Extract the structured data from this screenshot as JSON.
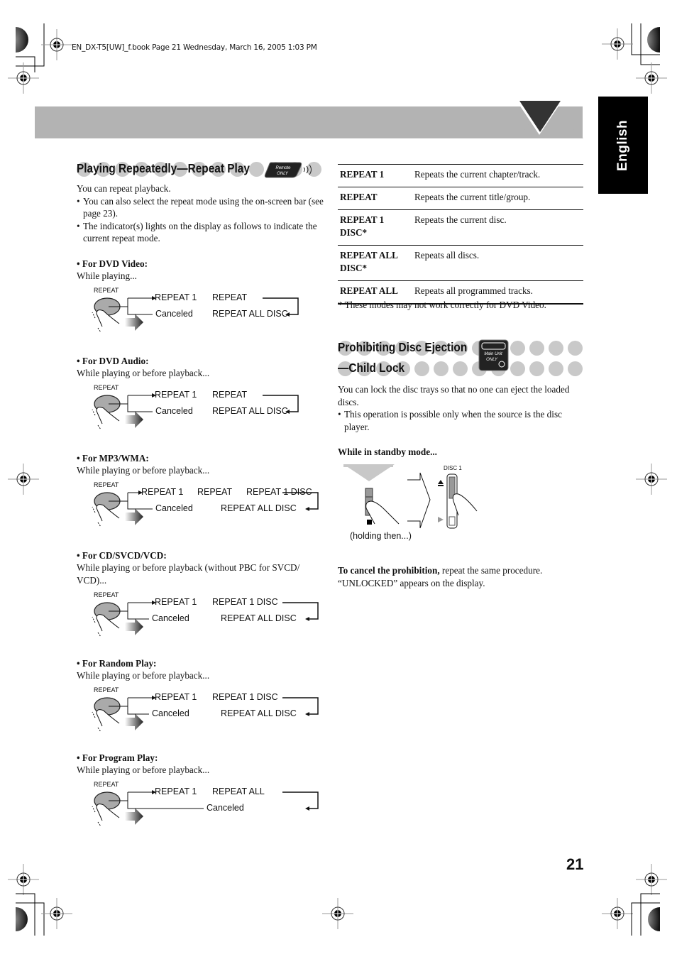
{
  "print_header": "EN_DX-T5[UW]_f.book  Page 21  Wednesday, March 16, 2005  1:03 PM",
  "language_tab": "English",
  "page_number": "21",
  "left": {
    "title": "Playing Repeatedly—Repeat Play",
    "badge": {
      "line1": "Remote",
      "line2": "ONLY"
    },
    "intro": "You can repeat playback.",
    "bullets": [
      "You can also select the repeat mode using the on-screen bar (see page 23).",
      "The indicator(s) lights on the display as follows to indicate the current repeat mode."
    ],
    "button_label": "REPEAT",
    "cases": [
      {
        "title": "• For DVD Video:",
        "condition": "While playing...",
        "top": [
          "REPEAT 1",
          "REPEAT"
        ],
        "bottom": [
          "Canceled",
          "REPEAT ALL DISC"
        ]
      },
      {
        "title": "• For DVD Audio:",
        "condition": "While playing or before playback...",
        "top": [
          "REPEAT 1",
          "REPEAT"
        ],
        "bottom": [
          "Canceled",
          "REPEAT ALL DISC"
        ]
      },
      {
        "title": "• For MP3/WMA:",
        "condition": "While playing or before playback...",
        "top": [
          "REPEAT 1",
          "REPEAT",
          "REPEAT 1 DISC"
        ],
        "bottom": [
          "Canceled",
          "REPEAT ALL DISC"
        ]
      },
      {
        "title": "• For CD/SVCD/VCD:",
        "condition": "While playing or before playback (without PBC for SVCD/ VCD)...",
        "top": [
          "REPEAT 1",
          "REPEAT 1 DISC"
        ],
        "bottom": [
          "Canceled",
          "REPEAT ALL DISC"
        ]
      },
      {
        "title": "• For Random Play:",
        "condition": "While playing or before playback...",
        "top": [
          "REPEAT 1",
          "REPEAT 1 DISC"
        ],
        "bottom": [
          "Canceled",
          "REPEAT ALL DISC"
        ]
      },
      {
        "title": "• For Program Play:",
        "condition": "While playing or before playback...",
        "top": [
          "REPEAT 1",
          "REPEAT ALL"
        ],
        "bottom": [
          "Canceled"
        ]
      }
    ]
  },
  "right": {
    "modes_table": [
      {
        "mode": "REPEAT 1",
        "desc": "Repeats the current chapter/track."
      },
      {
        "mode": "REPEAT",
        "desc": "Repeats the current title/group."
      },
      {
        "mode": "REPEAT 1 DISC*",
        "desc": "Repeats the current disc."
      },
      {
        "mode": "REPEAT ALL DISC*",
        "desc": "Repeats all discs."
      },
      {
        "mode": "REPEAT ALL",
        "desc": "Repeats all programmed tracks."
      }
    ],
    "footnote": "* These modes may not work correctly for DVD Video.",
    "title_line1": "Prohibiting Disc Ejection",
    "title_line2": "—Child Lock",
    "badge": {
      "line1": "Main Unit",
      "line2": "ONLY"
    },
    "intro": "You can lock the disc trays so that no one can eject the loaded discs.",
    "bullet": "This operation is possible only when the source is the disc player.",
    "standby_label": "While in standby mode...",
    "disc_label": "DISC 1",
    "holding_label": "(holding then...)",
    "cancel_bold": "To cancel the prohibition,",
    "cancel_text": " repeat the same procedure.",
    "unlocked_text": "“UNLOCKED” appears on the display."
  }
}
